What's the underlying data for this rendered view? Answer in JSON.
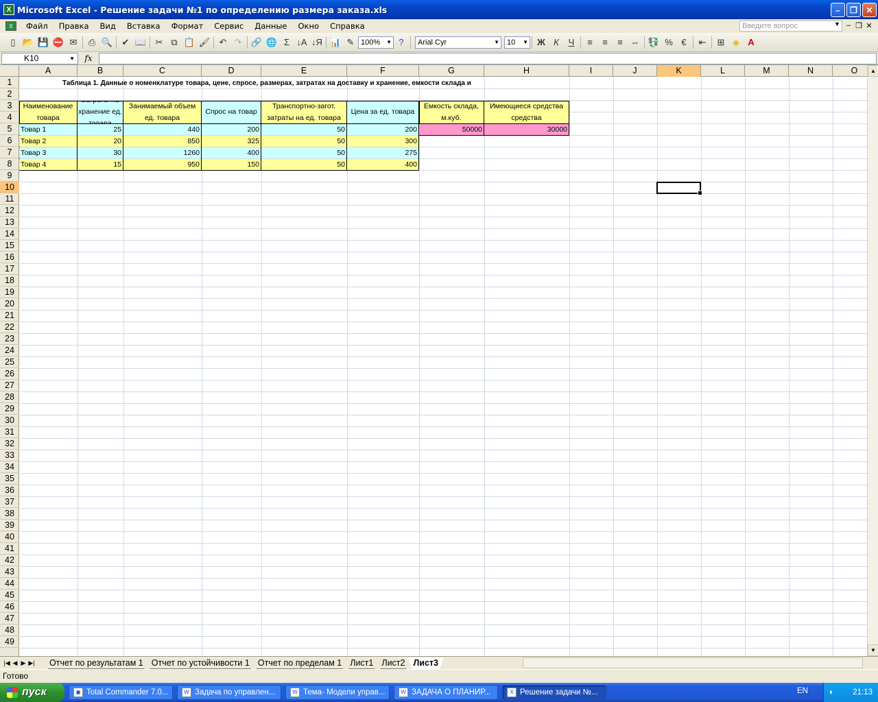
{
  "window": {
    "title": "Microsoft Excel - Решение задачи №1 по определению размера заказа.xls"
  },
  "menu": [
    "Файл",
    "Правка",
    "Вид",
    "Вставка",
    "Формат",
    "Сервис",
    "Данные",
    "Окно",
    "Справка"
  ],
  "ask_placeholder": "Введите вопрос",
  "toolbar": {
    "zoom": "100%",
    "font": "Arial Cyr",
    "size": "10",
    "bold": "Ж",
    "italic": "К",
    "underline": "Ч",
    "percent": "%",
    "euro": "€",
    "sum": "Σ"
  },
  "formula": {
    "namebox": "K10",
    "fx": "fx",
    "content": ""
  },
  "columns": [
    "A",
    "B",
    "C",
    "D",
    "E",
    "F",
    "G",
    "H",
    "I",
    "J",
    "K",
    "L",
    "M",
    "N",
    "O"
  ],
  "selected_cell": "K10",
  "sheet": {
    "title": "Таблица 1. Данные о номенклатуре товара, цене, спросе, размерах, затратах на доставку и хранение, емкости склада и",
    "headers": [
      "Наименование товара",
      "Затраты на хранение ед. товара",
      "Занимаемый объем ед. товара",
      "Спрос на товар",
      "Транспортно-загот. затраты на ед. товара",
      "Цена за ед. товара",
      "Емкость склада, м.куб.",
      "Имеющиеся средства средства"
    ],
    "rows": [
      [
        "Товар 1",
        "25",
        "440",
        "200",
        "50",
        "200",
        "50000",
        "30000"
      ],
      [
        "Товар 2",
        "20",
        "850",
        "325",
        "50",
        "300"
      ],
      [
        "Товар 3",
        "30",
        "1260",
        "400",
        "50",
        "275"
      ],
      [
        "Товар 4",
        "15",
        "950",
        "150",
        "50",
        "400"
      ]
    ],
    "colors": {
      "yellow": "#ffff99",
      "cyan": "#ccffff",
      "pink": "#ff99cc"
    }
  },
  "tabs": [
    "Отчет по результатам 1",
    "Отчет по устойчивости 1",
    "Отчет по пределам 1",
    "Лист1",
    "Лист2",
    "Лист3"
  ],
  "active_tab": "Лист3",
  "status": "Готово",
  "taskbar": {
    "start": "пуск",
    "items": [
      "Total Commander 7.0...",
      "Задача по управлен...",
      "Тема- Модели управ...",
      "ЗАДАЧА О ПЛАНИР...",
      "Решение задачи №..."
    ],
    "lang": "EN",
    "clock": "21:13"
  }
}
